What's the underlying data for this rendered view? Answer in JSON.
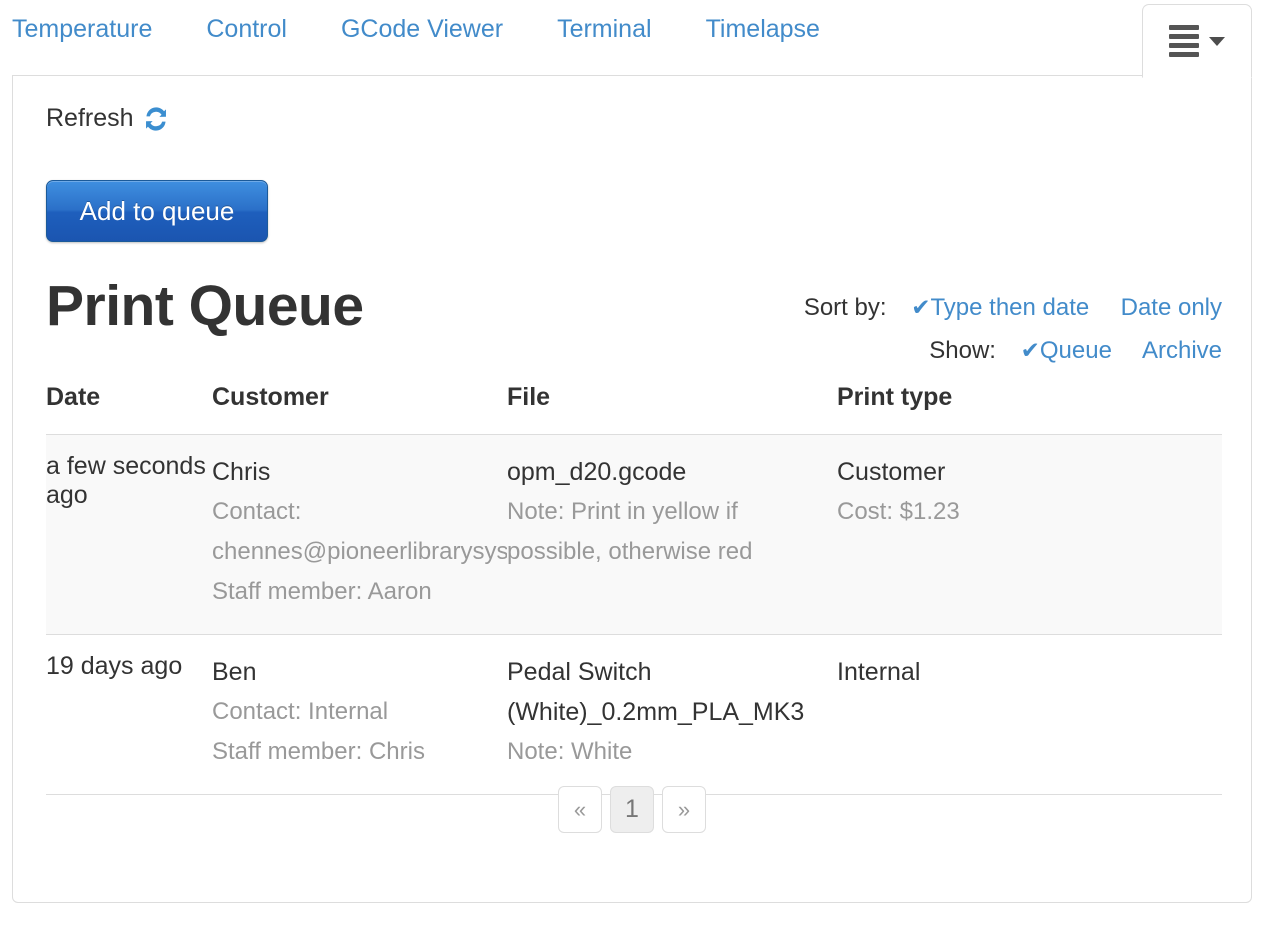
{
  "tabs": [
    {
      "label": "Temperature"
    },
    {
      "label": "Control"
    },
    {
      "label": "GCode Viewer"
    },
    {
      "label": "Terminal"
    },
    {
      "label": "Timelapse"
    }
  ],
  "menu_tab": {
    "icon": "hamburger-icon",
    "caret": "chevron-down-icon"
  },
  "toolbar": {
    "refresh_label": "Refresh",
    "refresh_icon": "refresh-icon",
    "add_to_queue_label": "Add to queue"
  },
  "header": {
    "title": "Print Queue",
    "sort_by_label": "Sort by:",
    "sort_options": [
      {
        "label": "Type then date",
        "selected": true
      },
      {
        "label": "Date only",
        "selected": false
      }
    ],
    "show_label": "Show:",
    "show_options": [
      {
        "label": "Queue",
        "selected": true
      },
      {
        "label": "Archive",
        "selected": false
      }
    ],
    "check_glyph": "✔"
  },
  "table": {
    "columns": [
      "Date",
      "Customer",
      "File",
      "Print type"
    ],
    "rows": [
      {
        "date": "a few seconds ago",
        "customer_name": "Chris",
        "customer_contact": "Contact: chennes@pioneerlibrarysys",
        "customer_staff": "Staff member: Aaron",
        "file_name": "opm_d20.gcode",
        "file_note": "Note: Print in yellow if possible, otherwise red",
        "print_type": "Customer",
        "print_cost": "Cost: $1.23",
        "actions": [
          "open-folder-icon",
          "edit-pencil-icon",
          "archive-icon"
        ]
      },
      {
        "date": "19 days ago",
        "customer_name": "Ben",
        "customer_contact": "Contact: Internal",
        "customer_staff": "Staff member: Chris",
        "file_name": "Pedal Switch (White)_0.2mm_PLA_MK3",
        "file_note": "Note: White",
        "print_type": "Internal",
        "print_cost": "",
        "actions": [
          "open-folder-icon",
          "edit-pencil-icon",
          "archive-icon"
        ]
      }
    ]
  },
  "pagination": {
    "prev_label": "«",
    "pages": [
      "1"
    ],
    "next_label": "»",
    "current_page": "1"
  },
  "colors": {
    "link": "#428bca",
    "primary_button": "#2b6fc6",
    "text": "#333333",
    "muted": "#999999",
    "border": "#dddddd",
    "row_stripe": "#f9f9f9"
  }
}
